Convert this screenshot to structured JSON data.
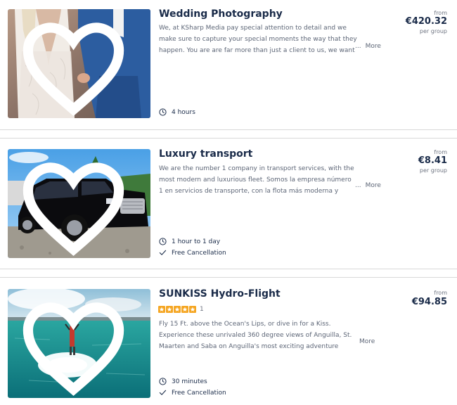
{
  "listings": [
    {
      "title": "Wedding Photography",
      "description": "We, at KSharp Media pay special attention to detail and we make sure to capture your special moments the way that they happen. You are are far more than just a client to us, we want to make su...",
      "more_label": "More",
      "price_from": "from",
      "price": "€420.32",
      "price_unit": "per group",
      "duration": "4 hours",
      "icons": [
        "heart-icon",
        "clock-icon"
      ]
    },
    {
      "title": "Luxury transport",
      "description": "We are the number 1 company in transport services, with the most modern and luxurious fleet. Somos la empresa número 1 en servicios de transporte, con la flota más moderna y lujosa.",
      "more_label": "More",
      "price_from": "from",
      "price": "€8.41",
      "price_unit": "per group",
      "duration": "1 hour to 1 day",
      "cancellation": "Free Cancellation",
      "icons": [
        "heart-icon",
        "clock-icon",
        "checkmark-icon"
      ]
    },
    {
      "title": "SUNKISS Hydro-Flight",
      "rating": 5,
      "rating_count": "1",
      "description": "Fly 15 Ft. above the Ocean's Lips, or dive in for a Kiss. Experience these unrivaled 360 degree views of Anguilla, St. Maarten and Saba on Anguilla's most exciting adventure experience to date. Do...",
      "more_label": "More",
      "price_from": "from",
      "price": "€94.85",
      "duration": "30 minutes",
      "cancellation": "Free Cancellation",
      "icons": [
        "heart-icon",
        "star-icon",
        "clock-icon",
        "checkmark-icon"
      ]
    }
  ],
  "colors": {
    "title": "#1a2b49",
    "body_text": "#5c6576",
    "star": "#f5a623",
    "divider": "#d8d8d8"
  }
}
